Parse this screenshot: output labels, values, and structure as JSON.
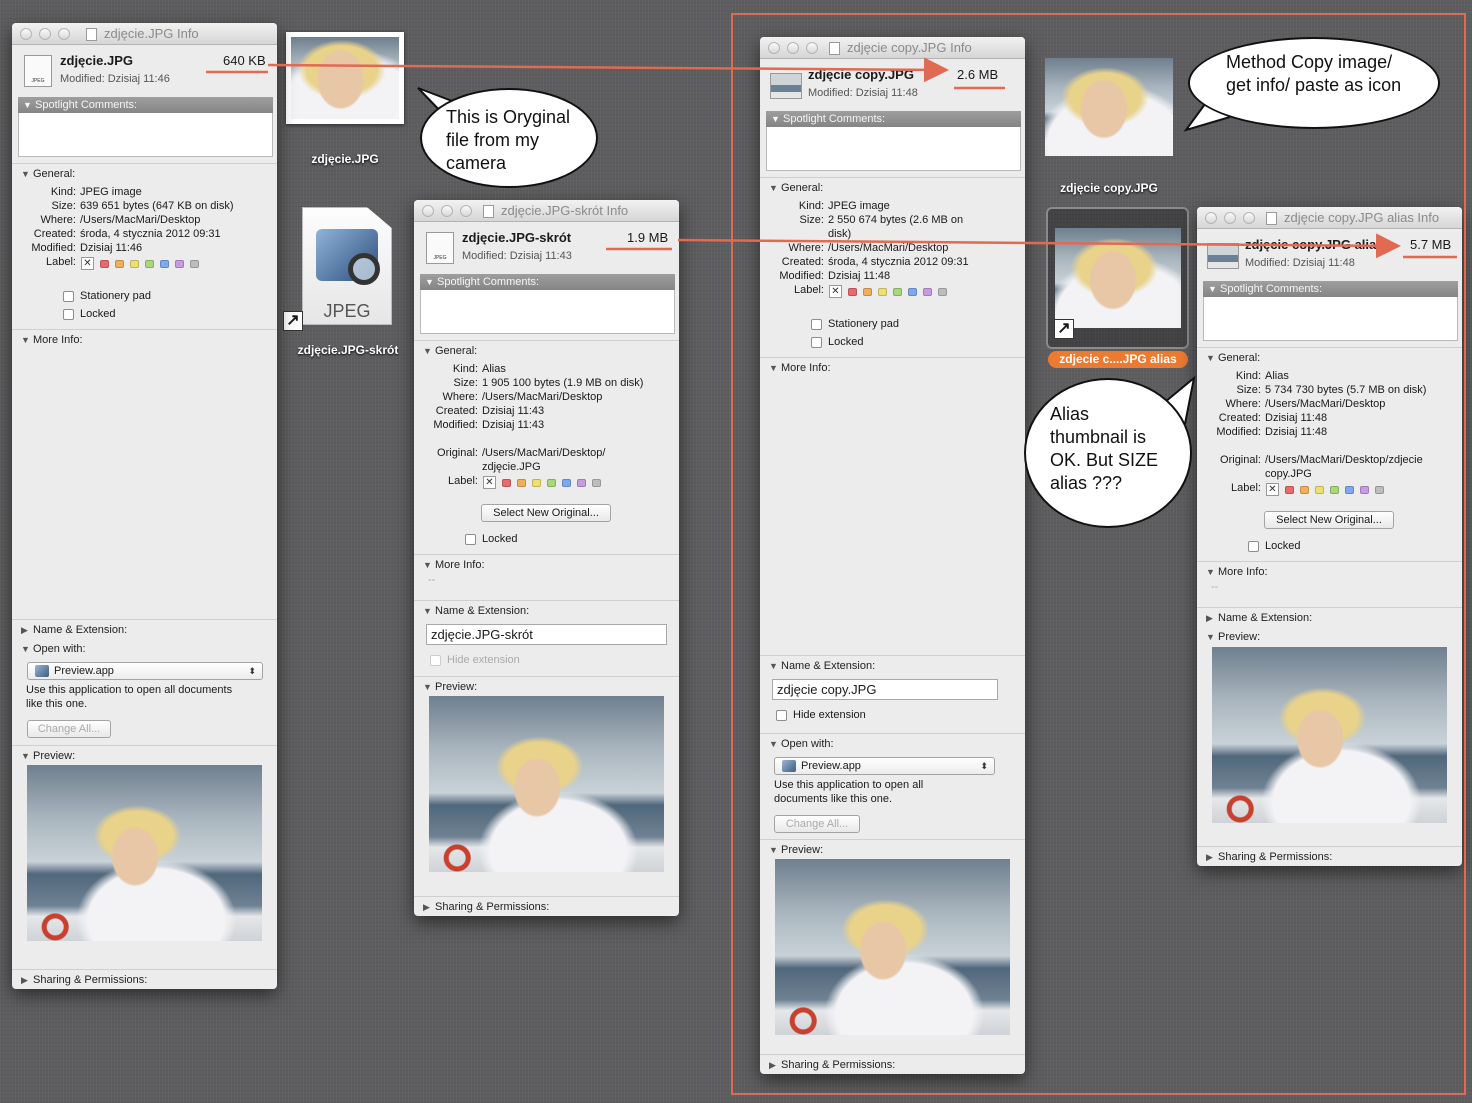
{
  "desktop": {
    "orig_label": "zdjęcie.JPG",
    "alias1_label": "zdjęcie.JPG-skrót",
    "copy_label": "zdjęcie copy.JPG",
    "alias2_label": "zdjecie c....JPG alias",
    "jpeg_text": "JPEG"
  },
  "bubbles": {
    "b1": [
      "This is Oryginal",
      "file from my",
      "camera"
    ],
    "b2": [
      "Method Copy image/",
      "get info/ paste as icon"
    ],
    "b3": [
      "Alias",
      "thumbnail is",
      "OK. But SIZE",
      "alias ???"
    ]
  },
  "w1": {
    "title": "zdjęcie.JPG Info",
    "name": "zdjęcie.JPG",
    "modified": "Modified: Dzisiaj 11:46",
    "size": "640 KB",
    "spotlight": "Spotlight Comments:",
    "general": "General:",
    "rows": [
      {
        "k": "Kind:",
        "v": "JPEG image"
      },
      {
        "k": "Size:",
        "v": "639 651 bytes (647 KB on disk)"
      },
      {
        "k": "Where:",
        "v": "/Users/MacMari/Desktop"
      },
      {
        "k": "Created:",
        "v": "środa, 4 stycznia 2012 09:31"
      },
      {
        "k": "Modified:",
        "v": "Dzisiaj 11:46"
      }
    ],
    "label": "Label:",
    "stationery": "Stationery pad",
    "locked": "Locked",
    "more_info": "More Info:",
    "name_ext": "Name & Extension:",
    "open_with": "Open with:",
    "app": "Preview.app",
    "use_app": [
      "Use this application to open all documents",
      "like this one."
    ],
    "change_all": "Change All...",
    "preview": "Preview:",
    "sharing": "Sharing & Permissions:",
    "icon_text": "JPEG"
  },
  "w2": {
    "title": "zdjęcie.JPG-skrót Info",
    "name": "zdjęcie.JPG-skrót",
    "modified": "Modified: Dzisiaj 11:43",
    "size": "1.9 MB",
    "spotlight": "Spotlight Comments:",
    "general": "General:",
    "rows": [
      {
        "k": "Kind:",
        "v": "Alias"
      },
      {
        "k": "Size:",
        "v": "1 905 100 bytes (1.9 MB on disk)"
      },
      {
        "k": "Where:",
        "v": "/Users/MacMari/Desktop"
      },
      {
        "k": "Created:",
        "v": "Dzisiaj 11:43"
      },
      {
        "k": "Modified:",
        "v": "Dzisiaj 11:43"
      }
    ],
    "original_k": "Original:",
    "original_v": [
      "/Users/MacMari/Desktop/",
      "zdjęcie.JPG"
    ],
    "label": "Label:",
    "select_original": "Select New Original...",
    "locked": "Locked",
    "more_info": "More Info:",
    "more_info_val": "--",
    "name_ext": "Name & Extension:",
    "name_field": "zdjęcie.JPG-skrót",
    "hide_ext": "Hide extension",
    "preview": "Preview:",
    "sharing": "Sharing & Permissions:",
    "icon_text": "JPEG"
  },
  "w3": {
    "title": "zdjęcie copy.JPG Info",
    "name": "zdjęcie copy.JPG",
    "modified": "Modified: Dzisiaj 11:48",
    "size": "2.6 MB",
    "spotlight": "Spotlight Comments:",
    "general": "General:",
    "rows": [
      {
        "k": "Kind:",
        "v": "JPEG image"
      },
      {
        "k": "Size:",
        "v": "2 550 674 bytes (2.6 MB on"
      },
      {
        "k": "",
        "v": "disk)"
      },
      {
        "k": "Where:",
        "v": "/Users/MacMari/Desktop"
      },
      {
        "k": "Created:",
        "v": "środa, 4 stycznia 2012 09:31"
      },
      {
        "k": "Modified:",
        "v": "Dzisiaj 11:48"
      }
    ],
    "label": "Label:",
    "stationery": "Stationery pad",
    "locked": "Locked",
    "more_info": "More Info:",
    "name_ext": "Name & Extension:",
    "name_field": "zdjęcie copy.JPG",
    "hide_ext": "Hide extension",
    "open_with": "Open with:",
    "app": "Preview.app",
    "use_app": [
      "Use this application to open all",
      "documents like this one."
    ],
    "change_all": "Change All...",
    "preview": "Preview:",
    "sharing": "Sharing & Permissions:"
  },
  "w4": {
    "title": "zdjęcie copy.JPG alias Info",
    "name": "zdjęcie copy.JPG alias",
    "modified": "Modified: Dzisiaj 11:48",
    "size": "5.7 MB",
    "spotlight": "Spotlight Comments:",
    "general": "General:",
    "rows": [
      {
        "k": "Kind:",
        "v": "Alias"
      },
      {
        "k": "Size:",
        "v": "5 734 730 bytes (5.7 MB on disk)"
      },
      {
        "k": "Where:",
        "v": "/Users/MacMari/Desktop"
      },
      {
        "k": "Created:",
        "v": "Dzisiaj 11:48"
      },
      {
        "k": "Modified:",
        "v": "Dzisiaj 11:48"
      }
    ],
    "original_k": "Original:",
    "original_v": [
      "/Users/MacMari/Desktop/zdjecie",
      "copy.JPG"
    ],
    "label": "Label:",
    "select_original": "Select New Original...",
    "locked": "Locked",
    "more_info": "More Info:",
    "more_info_val": "--",
    "name_ext": "Name & Extension:",
    "preview": "Preview:",
    "sharing": "Sharing & Permissions:"
  },
  "colors": {
    "annotation": "#e06a52",
    "selection": "#ec7a30",
    "label_colors": [
      "#e86a6a",
      "#f0b05a",
      "#eee070",
      "#a9d87a",
      "#7ea9ef",
      "#c79be0",
      "#bdbdbd"
    ]
  }
}
